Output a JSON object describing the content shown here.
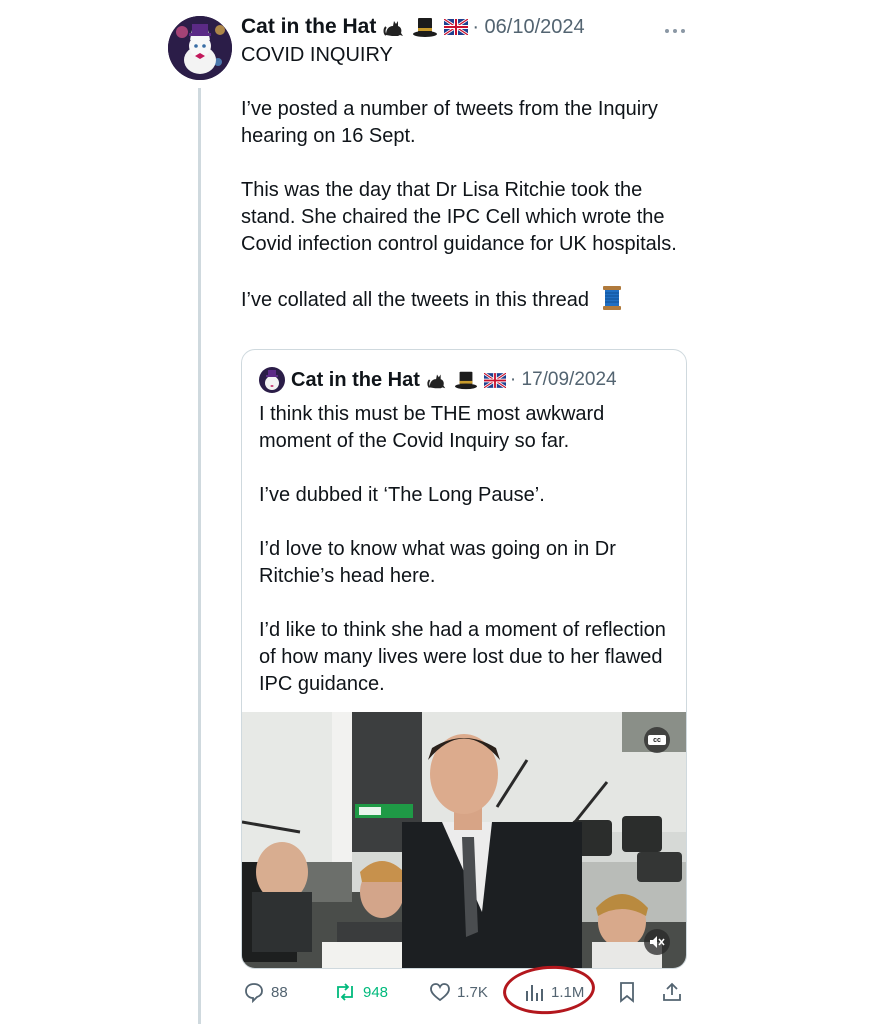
{
  "tweet": {
    "author_name": "Cat in the Hat",
    "author_emojis": [
      "cat-icon",
      "top-hat-icon",
      "uk-flag-icon"
    ],
    "date": "· 06/10/2024",
    "title": "COVID INQUIRY",
    "paragraphs": [
      "I’ve posted a number of tweets from the Inquiry hearing on 16 Sept.",
      "This was the day that Dr Lisa Ritchie took the stand. She chaired the IPC Cell which wrote the Covid infection control guidance for UK hospitals.",
      "I’ve collated all the tweets in this thread"
    ],
    "thread_emoji": "spool-of-thread-icon"
  },
  "quoted": {
    "author_name": "Cat in the Hat",
    "date": "· 17/09/2024",
    "paragraphs": [
      "I think this must be THE most awkward moment of the Covid Inquiry so far.",
      "I’ve dubbed it ‘The Long Pause’.",
      "I’d love to know what was going on in Dr Ritchie’s head here.",
      "I’d like to think she had a moment of reflection of how many lives were lost due to her flawed IPC guidance."
    ],
    "video": {
      "cc_label": "cc",
      "mute_icon": "muted-speaker-icon"
    }
  },
  "actions": {
    "replies": "88",
    "retweets": "948",
    "likes": "1.7K",
    "views": "1.1M"
  },
  "colors": {
    "text": "#0f1419",
    "muted": "#536471",
    "retweet_green": "#00ba7c",
    "annotation_red": "#b3171d"
  }
}
